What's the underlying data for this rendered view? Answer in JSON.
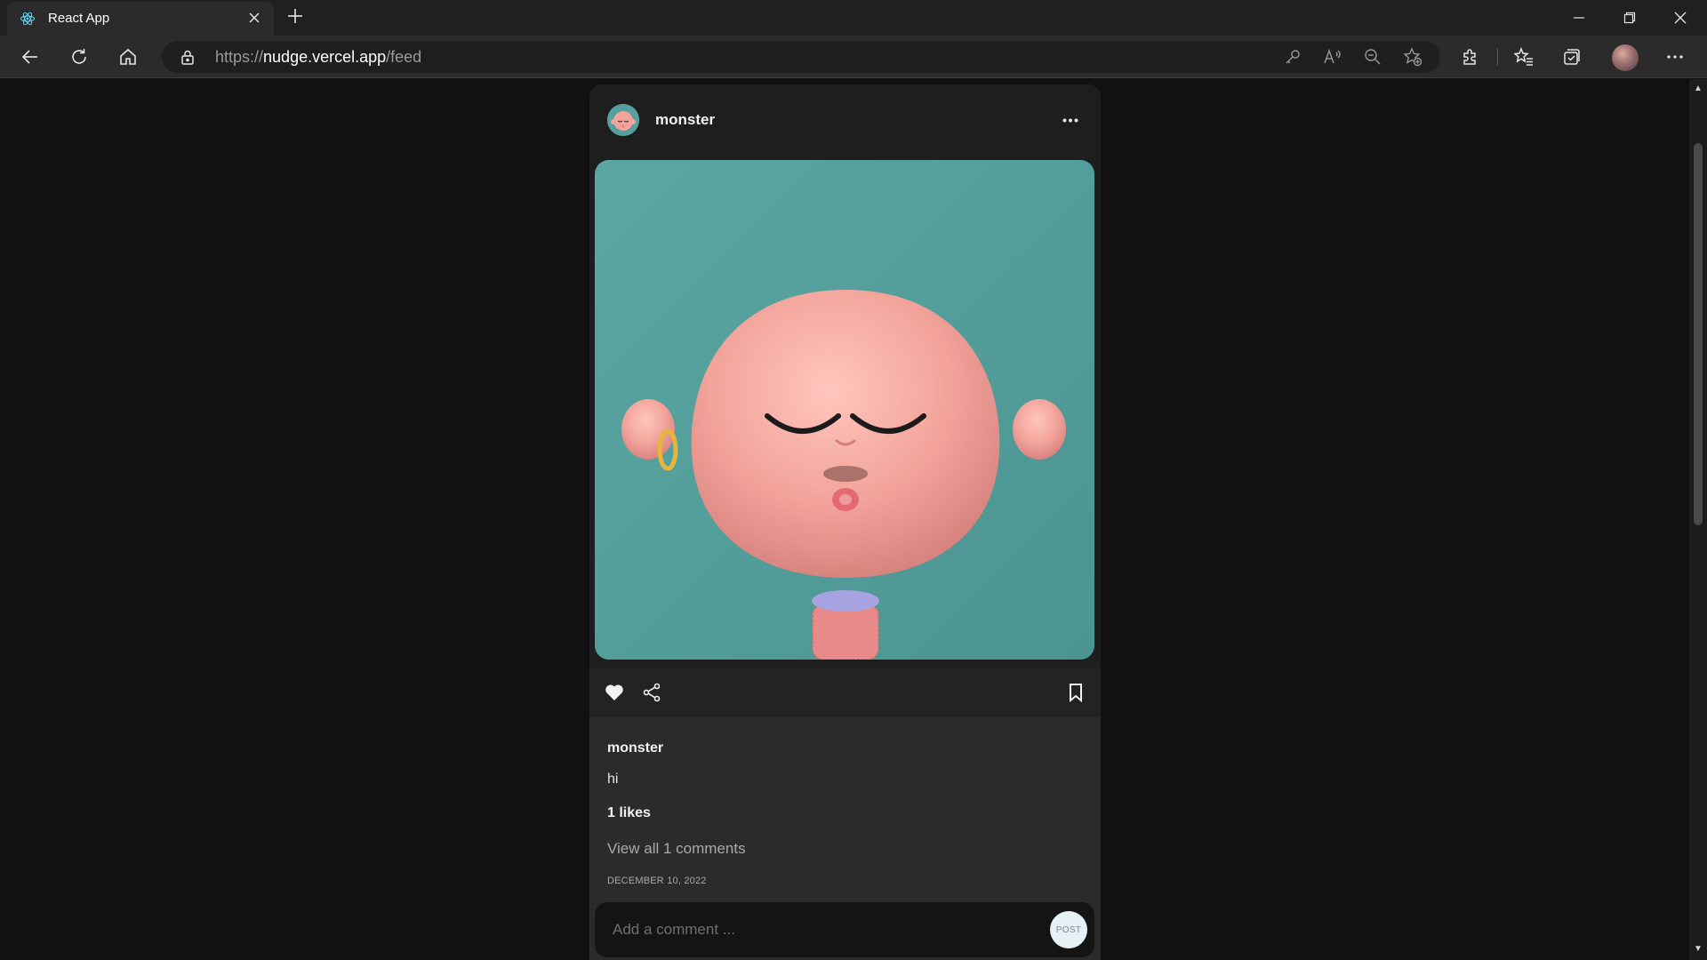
{
  "browser": {
    "tab_title": "React App",
    "url_scheme": "https://",
    "url_host": "nudge.vercel.app",
    "url_path": "/feed"
  },
  "post": {
    "username": "monster",
    "caption_username": "monster",
    "caption": "hi",
    "likes_text": "1 likes",
    "comments_text": "View all 1 comments",
    "date": "DECEMBER 10, 2022",
    "comment_placeholder": "Add a comment ...",
    "post_button": "POST"
  },
  "colors": {
    "page_bg": "#111111",
    "card_bg": "#1e1e1e",
    "image_bg": "#55a09e",
    "face": "#f2a39a"
  },
  "icons": [
    "react-favicon",
    "close-icon",
    "plus-icon",
    "back-icon",
    "refresh-icon",
    "home-icon",
    "lock-icon",
    "key-icon",
    "read-aloud-icon",
    "zoom-out-icon",
    "add-favorite-icon",
    "extensions-icon",
    "favorites-icon",
    "collections-icon",
    "more-icon",
    "heart-icon",
    "share-icon",
    "bookmark-icon"
  ]
}
